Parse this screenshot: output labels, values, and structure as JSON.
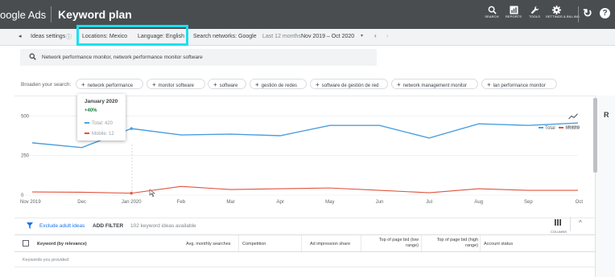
{
  "app": {
    "brand": "oogle Ads",
    "title": "Keyword plan"
  },
  "toolbar": {
    "search_label": "SEARCH",
    "reports_label": "REPORTS",
    "tools_label": "TOOLS",
    "settings_label": "SETTINGS & BILLING"
  },
  "settings_bar": {
    "ideas_settings": "Ideas settings",
    "locations": "Locations: Mexico",
    "language": "Language: English",
    "search_networks": "Search networks: Google",
    "period_label": "Last 12 months",
    "period_value": "Nov 2019 – Oct 2020"
  },
  "search": {
    "query": "Network performance monitor, network performance monitor software"
  },
  "broaden": {
    "label": "Broaden your search:",
    "chips": [
      "network performance",
      "monitor software",
      "software",
      "gestión de redes",
      "software de gestión de red",
      "network management monitor",
      "lan performance monitor"
    ]
  },
  "tooltip": {
    "title": "January 2020",
    "change": "+40%",
    "total": "Total: 420",
    "mobile": "Mobile: 12"
  },
  "chart_controls": {
    "trend_label": "GRAPHS",
    "legend_total": "Total",
    "legend_mobile": "Mobile",
    "total_color": "#4a9fe0",
    "mobile_color": "#e0533d"
  },
  "chart_data": {
    "type": "line",
    "categories": [
      "Nov 2019",
      "Dec",
      "Jan 2020",
      "Feb",
      "Mar",
      "Apr",
      "May",
      "Jun",
      "Jul",
      "Aug",
      "Sep",
      "Oct"
    ],
    "yticks": [
      0,
      250,
      500
    ],
    "ylim": [
      0,
      750
    ],
    "series": [
      {
        "name": "Total",
        "values": [
          330,
          300,
          420,
          380,
          385,
          375,
          440,
          440,
          360,
          450,
          440,
          455
        ]
      },
      {
        "name": "Mobile",
        "values": [
          20,
          18,
          12,
          55,
          35,
          40,
          45,
          30,
          15,
          40,
          30,
          30
        ]
      }
    ]
  },
  "filter_bar": {
    "exclude": "Exclude adult ideas",
    "add_filter": "ADD FILTER",
    "available": "102 keyword ideas available",
    "columns": "COLUMNS"
  },
  "table": {
    "headers": [
      "Keyword (by relevance)",
      "Avg. monthly searches",
      "Competition",
      "Ad impression share",
      "Top of page bid (low range)",
      "Top of page bid (high range)",
      "Account status"
    ],
    "first_row": "Keywords you provided"
  }
}
